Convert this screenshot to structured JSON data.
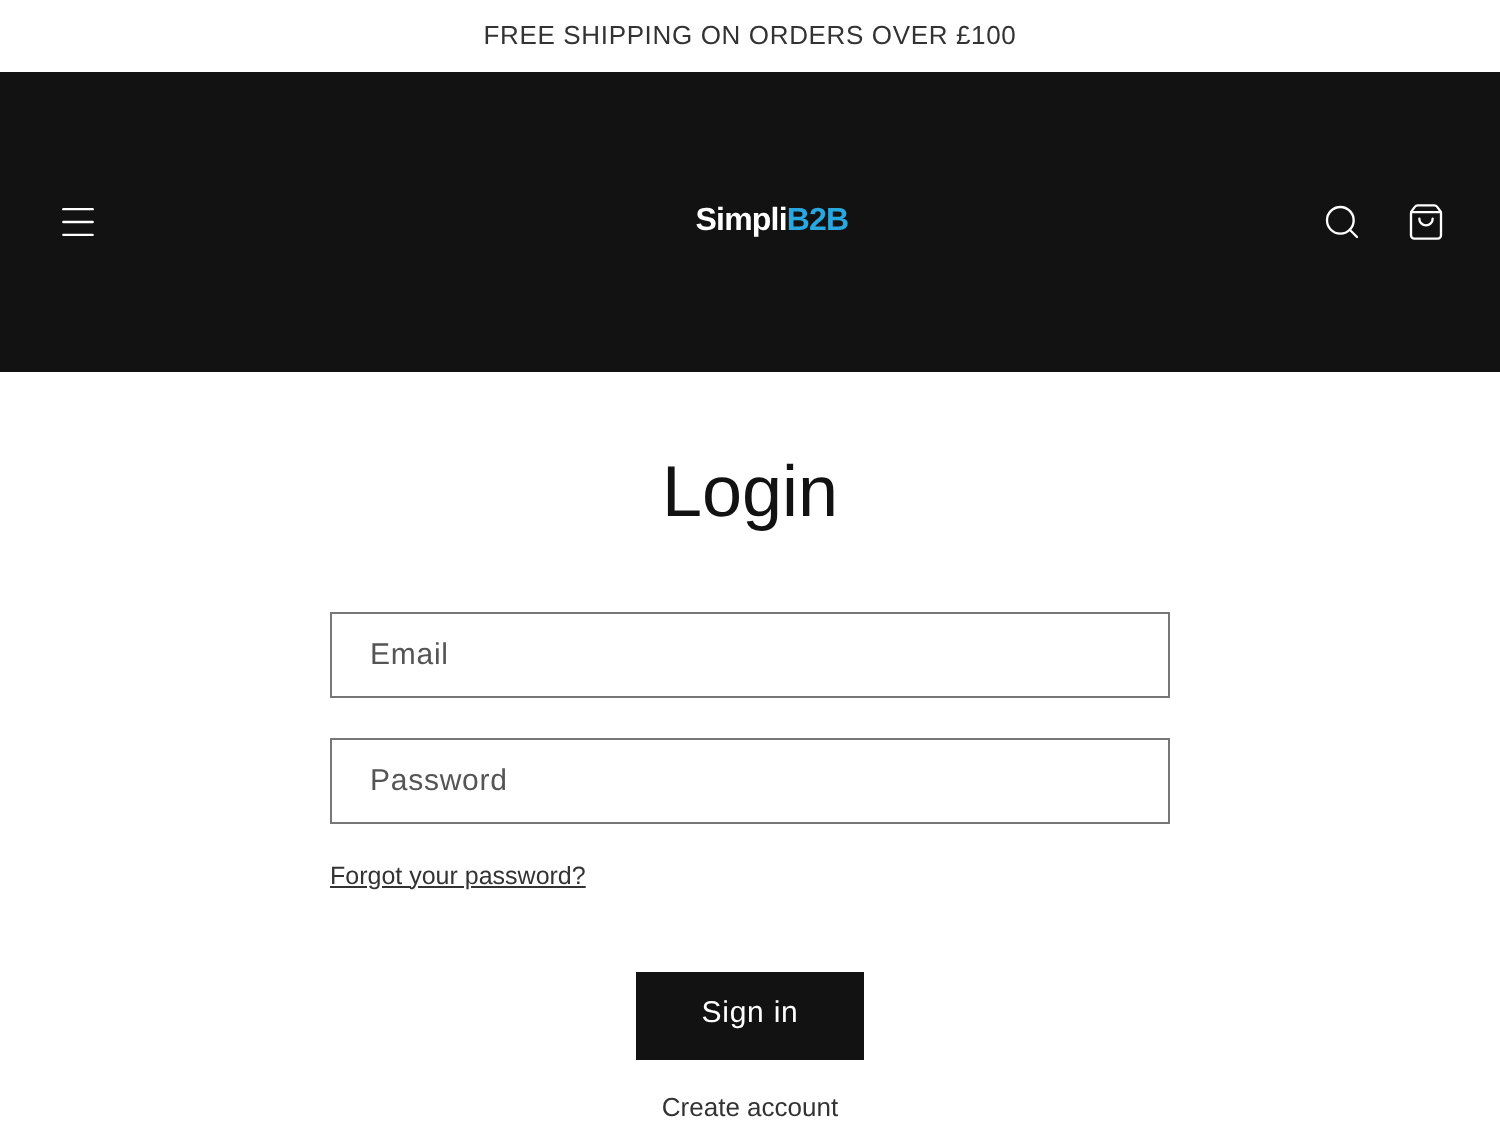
{
  "announcement": "FREE SHIPPING ON ORDERS OVER £100",
  "logo": {
    "text_1": "Simpli",
    "text_2": "B2B"
  },
  "title": "Login",
  "fields": [
    {
      "placeholder": "Email"
    },
    {
      "placeholder": "Password"
    }
  ],
  "forgot_link": "Forgot your password?",
  "sign_in_button": "Sign in",
  "create_account_link": "Create account"
}
